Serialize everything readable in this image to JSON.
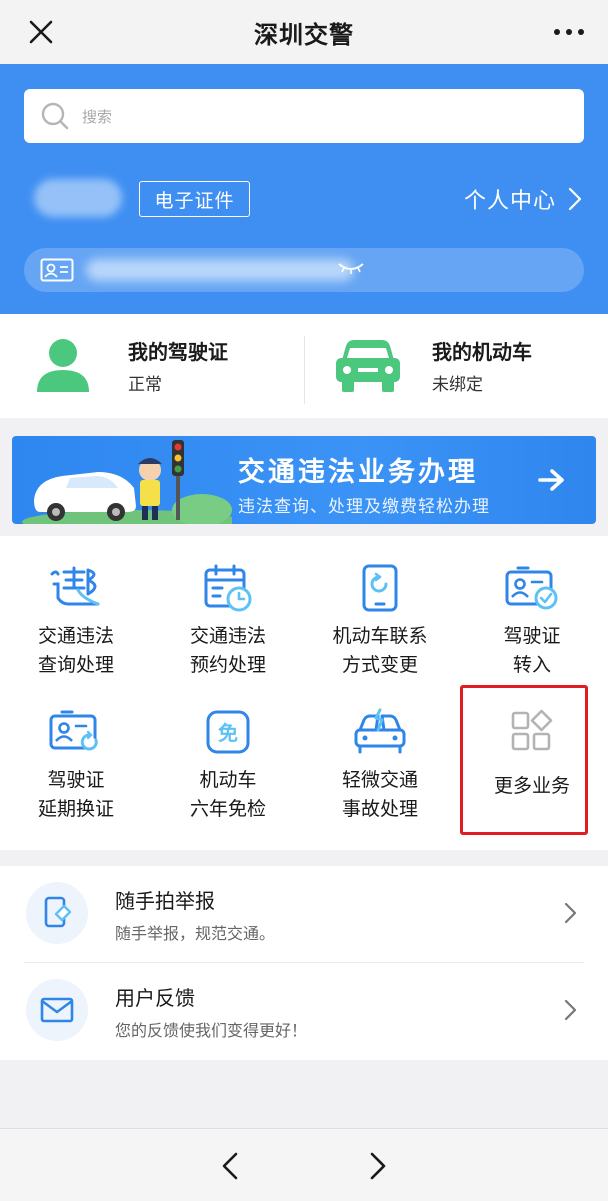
{
  "topbar": {
    "title": "深圳交警"
  },
  "search": {
    "placeholder": "搜索"
  },
  "hero": {
    "certificate_button": "电子证件",
    "personal_center": "个人中心"
  },
  "cards": [
    {
      "name": "我的驾驶证",
      "status": "正常"
    },
    {
      "name": "我的机动车",
      "status": "未绑定"
    }
  ],
  "banner": {
    "title": "交通违法业务办理",
    "subtitle": "违法查询、处理及缴费轻松办理"
  },
  "services": [
    {
      "label": "交通违法\n查询处理",
      "icon": "violation-icon"
    },
    {
      "label": "交通违法\n预约处理",
      "icon": "calendar-icon"
    },
    {
      "label": "机动车联系\n方式变更",
      "icon": "phone-refresh-icon"
    },
    {
      "label": "驾驶证\n转入",
      "icon": "license-transfer-icon"
    },
    {
      "label": "驾驶证\n延期换证",
      "icon": "license-renew-icon"
    },
    {
      "label": "机动车\n六年免检",
      "icon": "exempt-icon"
    },
    {
      "label": "轻微交通\n事故处理",
      "icon": "car-accident-icon"
    },
    {
      "label": "更多业务",
      "icon": "more-grid-icon"
    }
  ],
  "list": [
    {
      "title": "随手拍举报",
      "subtitle": "随手举报，规范交通。",
      "icon": "phone-report-icon"
    },
    {
      "title": "用户反馈",
      "subtitle": "您的反馈使我们变得更好！",
      "icon": "mail-icon"
    }
  ],
  "colors": {
    "brand_blue": "#3f8ff2",
    "icon_blue": "#2f86e8",
    "green": "#4cc77e",
    "highlight_red": "#e21d1d"
  }
}
